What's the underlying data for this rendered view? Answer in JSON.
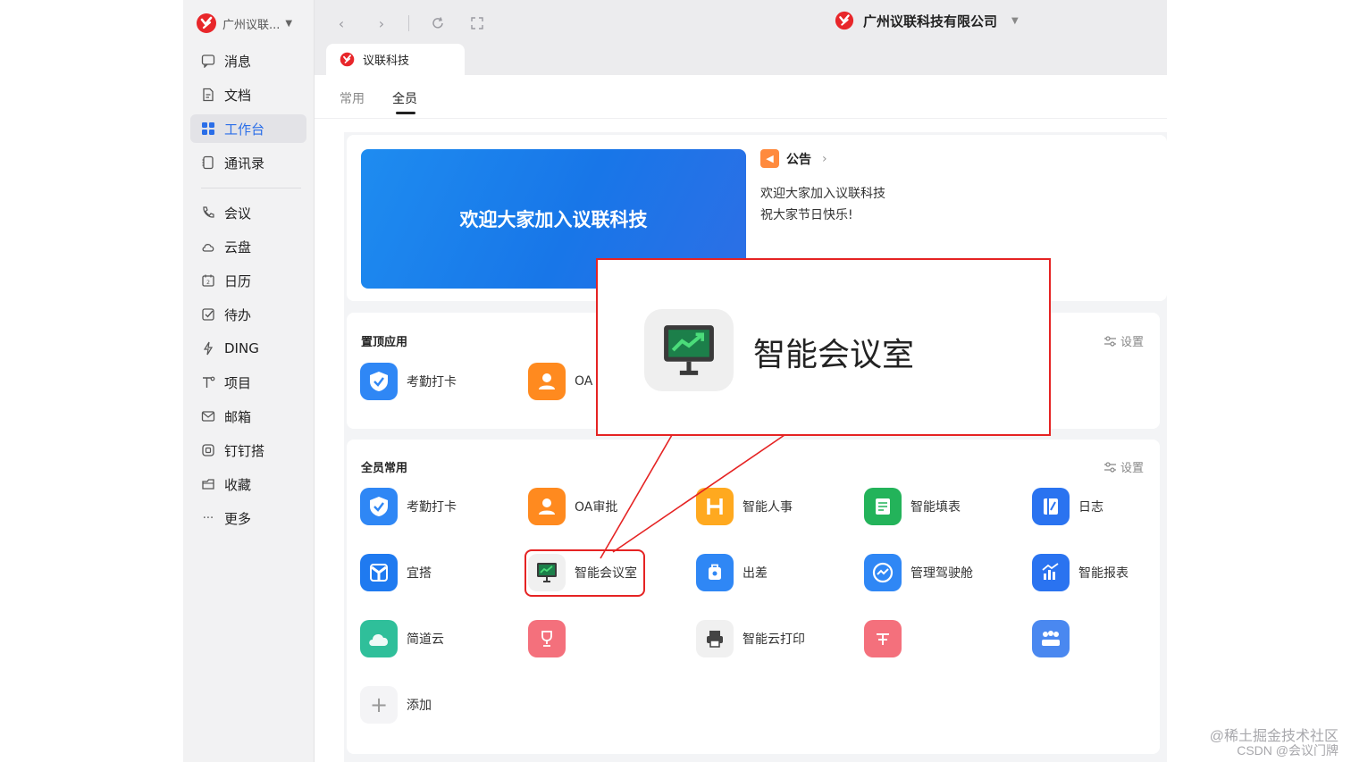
{
  "brand": {
    "color": "#e8262a",
    "accent": "#2a6ee8"
  },
  "sidebar": {
    "org_name": "广州议联...",
    "items": [
      {
        "label": "消息",
        "icon": "chat-icon"
      },
      {
        "label": "文档",
        "icon": "document-icon"
      },
      {
        "label": "工作台",
        "icon": "grid-icon"
      },
      {
        "label": "通讯录",
        "icon": "contacts-icon"
      },
      {
        "label": "会议",
        "icon": "phone-icon"
      },
      {
        "label": "云盘",
        "icon": "cloud-icon"
      },
      {
        "label": "日历",
        "icon": "calendar-icon"
      },
      {
        "label": "待办",
        "icon": "check-icon"
      },
      {
        "label": "DING",
        "icon": "lightning-icon"
      },
      {
        "label": "项目",
        "icon": "project-icon"
      },
      {
        "label": "邮箱",
        "icon": "mail-icon"
      },
      {
        "label": "钉钉搭",
        "icon": "builder-icon"
      },
      {
        "label": "收藏",
        "icon": "favorite-icon"
      },
      {
        "label": "更多",
        "icon": "more-icon"
      }
    ]
  },
  "topbar": {
    "company": "广州议联科技有限公司",
    "tab": "议联科技"
  },
  "subtabs": [
    "常用",
    "全员"
  ],
  "banner": {
    "text": "欢迎大家加入议联科技"
  },
  "announcement": {
    "title": "公告",
    "lines": [
      "欢迎大家加入议联科技",
      "祝大家节日快乐!"
    ]
  },
  "pinned": {
    "title": "置顶应用",
    "setting": "设置",
    "apps": [
      {
        "label": "考勤打卡",
        "color": "#2f87f5"
      },
      {
        "label": "OA",
        "color": "#ff8a1f"
      }
    ]
  },
  "common": {
    "title": "全员常用",
    "setting": "设置",
    "apps": [
      {
        "label": "考勤打卡",
        "color": "#2f87f5"
      },
      {
        "label": "OA审批",
        "color": "#ff8a1f"
      },
      {
        "label": "智能人事",
        "color": "#ffa91f"
      },
      {
        "label": "智能填表",
        "color": "#23b35a"
      },
      {
        "label": "日志",
        "color": "#2a73f0"
      },
      {
        "label": "宜搭",
        "color": "#1f7af0"
      },
      {
        "label": "智能会议室",
        "color": "#f0f0f0"
      },
      {
        "label": "出差",
        "color": "#2f87f5"
      },
      {
        "label": "管理驾驶舱",
        "color": "#2f87f5"
      },
      {
        "label": "智能报表",
        "color": "#2a73f0"
      },
      {
        "label": "简道云",
        "color": "#2fbf9a"
      },
      {
        "label": "",
        "color": "#f4707c"
      },
      {
        "label": "智能云打印",
        "color": "#f0f0f0"
      },
      {
        "label": "",
        "color": "#f4707c"
      },
      {
        "label": "",
        "color": "#4a88f0"
      }
    ],
    "add_label": "添加"
  },
  "callout": {
    "label": "智能会议室",
    "border_color": "#e52323"
  },
  "watermark": [
    "@稀土掘金技术社区",
    "CSDN @会议门牌"
  ]
}
